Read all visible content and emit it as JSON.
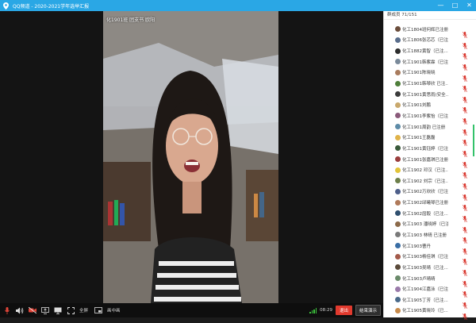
{
  "window": {
    "title": "QQ频道 - 2020-2021学年选举汇报",
    "controls": [
      "—",
      "□",
      "✕"
    ]
  },
  "video": {
    "caption": "化1901班 团支书 欧阳"
  },
  "toolbar": {
    "fullscreen_label": "全屏",
    "pip_label": "画中画",
    "time": "08:29",
    "leave_label": "退出",
    "end_label": "结束演示"
  },
  "members_panel": {
    "header": "群成员 71/151",
    "members": [
      {
        "name": "化工1804班何辉已注册",
        "avatar": "#6b4d3c"
      },
      {
        "name": "化工1806张芯芯（已注...",
        "avatar": "#5a6e8c"
      },
      {
        "name": "化工1882黄智（已注...",
        "avatar": "#2d2d2d"
      },
      {
        "name": "化工1901韩紫霖（已注...",
        "avatar": "#7a8a9a"
      },
      {
        "name": "化工1901陈晓晓",
        "avatar": "#a97c5e"
      },
      {
        "name": "化工1901韩琴欣 已注...",
        "avatar": "#4f7f3b"
      },
      {
        "name": "化工1901黄思雨(安全...",
        "avatar": "#3c3c3c"
      },
      {
        "name": "化工1901刘鹏",
        "avatar": "#c9a86c"
      },
      {
        "name": "化工1901李紫怡（已注...",
        "avatar": "#8a5a7a"
      },
      {
        "name": "化工1901周韵 已注册",
        "avatar": "#5e8ca8"
      },
      {
        "name": "化工1901王磊磊",
        "avatar": "#e0b34a"
      },
      {
        "name": "化工1901黄钰婷（已注...",
        "avatar": "#3a5a3a"
      },
      {
        "name": "化工1901张嘉琪已注册...",
        "avatar": "#9a3e3e"
      },
      {
        "name": "化工1902 邓汉（已注...",
        "avatar": "#e2c43a"
      },
      {
        "name": "化工1902 刘宗（已注...",
        "avatar": "#6d7f4a"
      },
      {
        "name": "化工1902万欣欣（已注...",
        "avatar": "#4e5f8a"
      },
      {
        "name": "化工1902邱曦琴已注册...",
        "avatar": "#b07a5a"
      },
      {
        "name": "化工1902屈毅（已注...",
        "avatar": "#2f4f6f"
      },
      {
        "name": "化工1903 潘晓婷（已注...",
        "avatar": "#8c6a4a"
      },
      {
        "name": "化工1903 林晴 已注册",
        "avatar": "#7a7a7a"
      },
      {
        "name": "化工1903曹丹",
        "avatar": "#3a6ea5"
      },
      {
        "name": "化工1903杨佳琪（已注...",
        "avatar": "#a35a4a"
      },
      {
        "name": "化工1903吴晴（已注...",
        "avatar": "#5a4a3a"
      },
      {
        "name": "化工1903卢晴晴",
        "avatar": "#6a8a6a"
      },
      {
        "name": "化工1904江嘉泳（已注...",
        "avatar": "#9a7aaa"
      },
      {
        "name": "化工1905丁芳（已注...",
        "avatar": "#4a6a8a"
      },
      {
        "name": "化工1905黄晓玲（已...",
        "avatar": "#c78a4a"
      }
    ]
  },
  "colors": {
    "titlebar": "#2aa7e5",
    "leave_button": "#e23a2e",
    "mic_muted": "#d9342b",
    "signal": "#3cc33c"
  },
  "icons": [
    "location-pin-icon",
    "microphone-icon",
    "speaker-icon",
    "camera-off-icon",
    "share-screen-icon",
    "monitor-icon",
    "fullscreen-icon",
    "pip-icon",
    "signal-icon",
    "mic-muted-icon"
  ]
}
